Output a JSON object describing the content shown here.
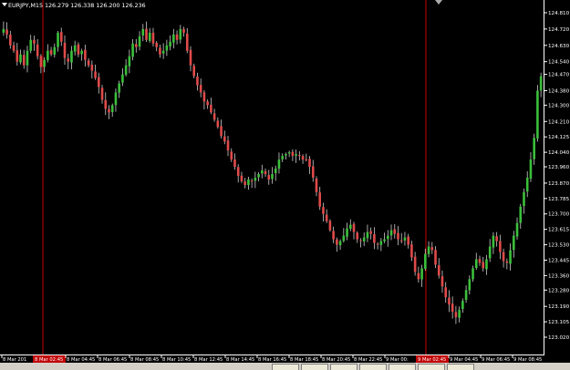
{
  "window": {
    "symbol_info": "EURJPY,M15  126.279 126.338 126.200 126.236"
  },
  "colors": {
    "background": "#000000",
    "bull": "#3bbf3b",
    "bear": "#e04a4a",
    "axis_text": "#ffffff",
    "separator": "#c80000",
    "label_highlight": "#c00000"
  },
  "chart_data": {
    "type": "candlestick",
    "timeframe": "M15",
    "ylim": [
      123.02,
      124.85
    ],
    "y_ticks": [
      "124.810",
      "124.720",
      "124.630",
      "124.540",
      "124.470",
      "124.380",
      "124.300",
      "124.210",
      "124.125",
      "124.040",
      "123.960",
      "123.870",
      "123.785",
      "123.700",
      "123.615",
      "123.530",
      "123.445",
      "123.360",
      "123.280",
      "123.190",
      "123.105",
      "123.020"
    ],
    "x_labels": [
      {
        "text": "8 Mar 201",
        "highlight": false
      },
      {
        "text": "8 Mar 02:45",
        "highlight": true
      },
      {
        "text": "8 Mar 04:45",
        "highlight": false
      },
      {
        "text": "8 Mar 06:45",
        "highlight": false
      },
      {
        "text": "8 Mar 08:45",
        "highlight": false
      },
      {
        "text": "8 Mar 10:45",
        "highlight": false
      },
      {
        "text": "8 Mar 12:45",
        "highlight": false
      },
      {
        "text": "8 Mar 14:45",
        "highlight": false
      },
      {
        "text": "8 Mar 16:45",
        "highlight": false
      },
      {
        "text": "8 Mar 18:45",
        "highlight": false
      },
      {
        "text": "8 Mar 20:45",
        "highlight": false
      },
      {
        "text": "8 Mar 22:45",
        "highlight": false
      },
      {
        "text": "9 Mar 00:",
        "highlight": false
      },
      {
        "text": "9 Mar 02:45",
        "highlight": true
      },
      {
        "text": "9 Mar 04:45",
        "highlight": false
      },
      {
        "text": "9 Mar 06:45",
        "highlight": false
      },
      {
        "text": "9 Mar 08:45",
        "highlight": false
      }
    ],
    "close_path": [
      124.72,
      124.69,
      124.63,
      124.6,
      124.54,
      124.58,
      124.52,
      124.6,
      124.66,
      124.64,
      124.57,
      124.51,
      124.55,
      124.6,
      124.58,
      124.62,
      124.7,
      124.65,
      124.56,
      124.54,
      124.6,
      124.63,
      124.58,
      124.6,
      124.55,
      124.52,
      124.49,
      124.45,
      124.4,
      124.33,
      124.28,
      124.26,
      124.3,
      124.37,
      124.42,
      124.47,
      124.52,
      124.57,
      124.64,
      124.62,
      124.68,
      124.72,
      124.66,
      124.7,
      124.64,
      124.62,
      124.58,
      124.6,
      124.63,
      124.65,
      124.69,
      124.66,
      124.72,
      124.7,
      124.6,
      124.52,
      124.46,
      124.41,
      124.37,
      124.32,
      124.3,
      124.26,
      124.22,
      124.18,
      124.13,
      124.1,
      124.05,
      124.0,
      123.96,
      123.91,
      123.88,
      123.86,
      123.89,
      123.88,
      123.9,
      123.92,
      123.94,
      123.92,
      123.89,
      123.92,
      123.95,
      124.0,
      124.02,
      124.03,
      124.04,
      124.02,
      124.03,
      124.02,
      124.0,
      124.0,
      123.96,
      123.9,
      123.82,
      123.74,
      123.7,
      123.66,
      123.61,
      123.56,
      123.53,
      123.55,
      123.58,
      123.62,
      123.64,
      123.6,
      123.56,
      123.55,
      123.57,
      123.6,
      123.59,
      123.54,
      123.53,
      123.55,
      123.56,
      123.58,
      123.61,
      123.59,
      123.56,
      123.55,
      123.57,
      123.53,
      123.46,
      123.38,
      123.34,
      123.4,
      123.48,
      123.52,
      123.5,
      123.42,
      123.36,
      123.3,
      123.24,
      123.2,
      123.16,
      123.13,
      123.17,
      123.22,
      123.28,
      123.34,
      123.4,
      123.45,
      123.43,
      123.4,
      123.45,
      123.52,
      123.58,
      123.55,
      123.49,
      123.44,
      123.43,
      123.5,
      123.58,
      123.65,
      123.74,
      123.82,
      123.9,
      124.0,
      124.12,
      124.38,
      124.46
    ]
  }
}
